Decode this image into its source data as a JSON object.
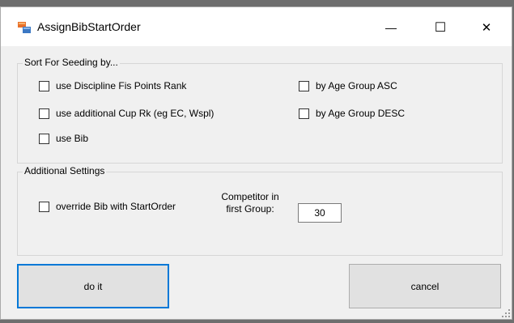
{
  "window": {
    "title": "AssignBibStartOrder",
    "minimize_glyph": "—",
    "maximize_glyph": "☐",
    "close_glyph": "✕"
  },
  "sort_group": {
    "label": "Sort For Seeding by...",
    "options": {
      "fis_points": "use Discipline Fis Points Rank",
      "cup_rank": "use additional Cup Rk (eg EC, Wspl)",
      "bib": "use Bib",
      "age_asc": "by Age Group ASC",
      "age_desc": "by Age Group DESC"
    }
  },
  "additional_group": {
    "label": "Additional Settings",
    "override_bib": "override Bib with StartOrder",
    "competitor_label_1": "Competitor in",
    "competitor_label_2": "first Group:",
    "competitor_value": "30"
  },
  "buttons": {
    "do_it": "do it",
    "cancel": "cancel"
  },
  "colors": {
    "focus_border": "#0078d7",
    "dialog_bg": "#f0f0f0"
  }
}
